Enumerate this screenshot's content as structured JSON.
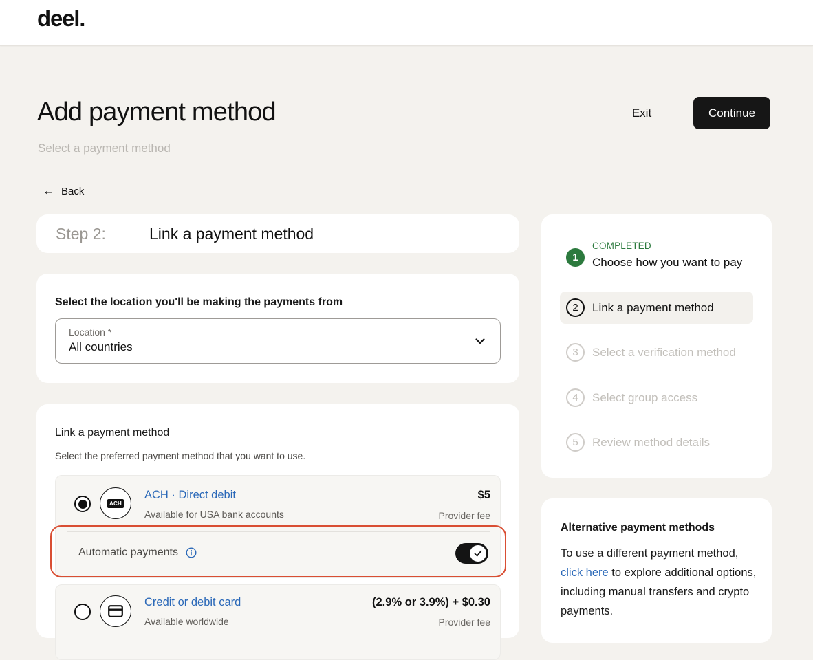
{
  "brand": {
    "logo_text": "deel."
  },
  "header": {
    "title": "Add payment method",
    "subtitle": "Select a payment method",
    "exit_label": "Exit",
    "continue_label": "Continue"
  },
  "back_label": "Back",
  "step": {
    "label": "Step 2:",
    "title": "Link a payment method"
  },
  "location": {
    "heading": "Select the location you'll be making the payments from",
    "field_label": "Location *",
    "value": "All countries"
  },
  "link_methods": {
    "heading": "Link a payment method",
    "subheading": "Select the preferred payment method that you want to use.",
    "methods": [
      {
        "badge": "ACH",
        "title": "ACH · Direct debit",
        "description": "Available for USA bank accounts",
        "fee": "$5",
        "fee_label": "Provider fee",
        "selected": true
      },
      {
        "title": "Credit or debit card",
        "description": "Available worldwide",
        "fee": "(2.9% or 3.9%) + $0.30",
        "fee_label": "Provider fee",
        "selected": false
      }
    ],
    "automatic_payments": {
      "label": "Automatic payments",
      "enabled": true
    }
  },
  "progress": {
    "completed_tag": "COMPLETED",
    "steps": [
      {
        "num": "1",
        "label": "Choose how you want to pay",
        "state": "completed"
      },
      {
        "num": "2",
        "label": "Link a payment method",
        "state": "active"
      },
      {
        "num": "3",
        "label": "Select a verification method",
        "state": "upcoming"
      },
      {
        "num": "4",
        "label": "Select group access",
        "state": "upcoming"
      },
      {
        "num": "5",
        "label": "Review method details",
        "state": "upcoming"
      }
    ]
  },
  "alternative": {
    "heading": "Alternative payment methods",
    "body_before": "To use a different payment method,",
    "link_text": "click here",
    "body_after": "to explore additional options, including manual transfers and crypto payments."
  },
  "colors": {
    "accent_link": "#2a68b8",
    "success": "#2c7a3e",
    "highlight": "#d94e33",
    "primary_button": "#161616",
    "page_bg": "#f4f2ee"
  }
}
